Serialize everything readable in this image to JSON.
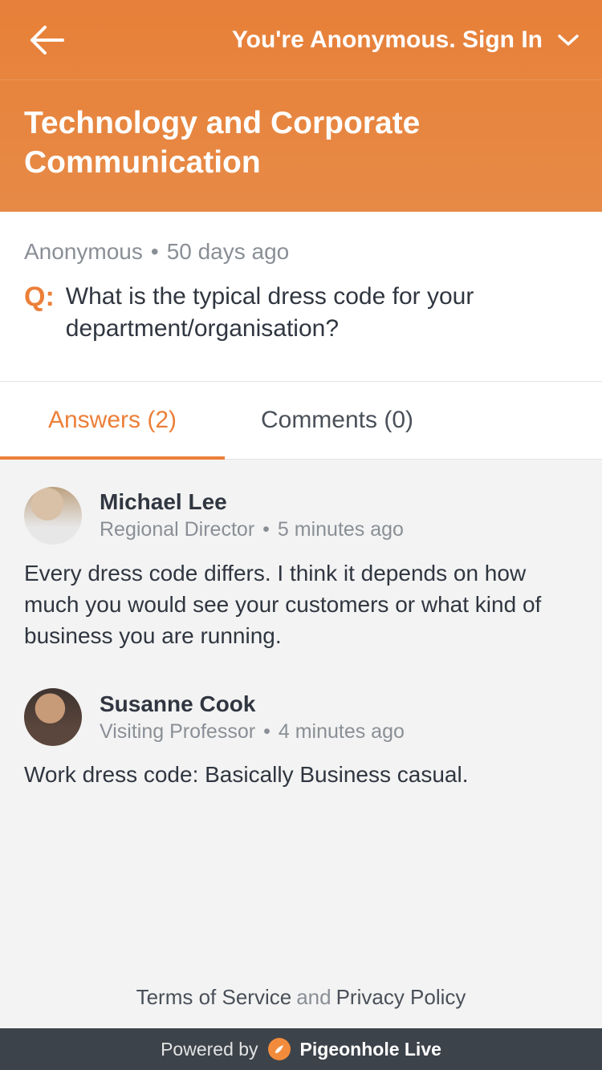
{
  "header": {
    "signin_text": "You're Anonymous. Sign In",
    "title": "Technology and Corporate Communication"
  },
  "question": {
    "author": "Anonymous",
    "time": "50 days ago",
    "prefix": "Q:",
    "text": "What is the typical dress code for your department/organisation?"
  },
  "tabs": {
    "answers_label": "Answers (2)",
    "comments_label": "Comments (0)"
  },
  "answers": [
    {
      "name": "Michael Lee",
      "role": "Regional Director",
      "time": "5 minutes ago",
      "body": "Every dress code differs. I think it depends on how much you would see your customers or what kind of business you are running.",
      "avatar_class": "male"
    },
    {
      "name": "Susanne Cook",
      "role": "Visiting Professor",
      "time": "4 minutes ago",
      "body": "Work dress code: Basically Business casual.",
      "avatar_class": "female"
    }
  ],
  "footer": {
    "terms": "Terms of Service",
    "and": "and",
    "privacy": "Privacy Policy",
    "powered_by": "Powered by",
    "brand": "Pigeonhole Live"
  }
}
